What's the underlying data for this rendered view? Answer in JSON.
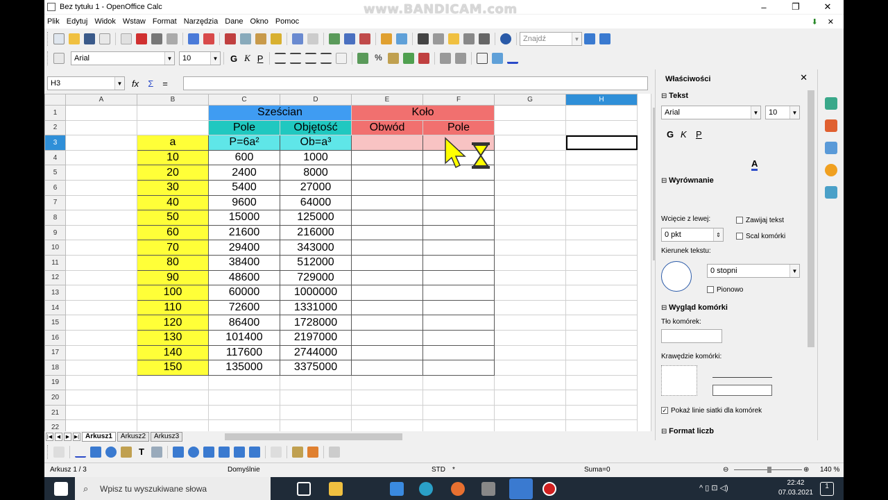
{
  "window": {
    "title": "Bez tytułu 1 - OpenOffice Calc",
    "watermark": "www.BANDICAM.com",
    "controls": [
      "–",
      "❐",
      "✕"
    ]
  },
  "menu": {
    "items": [
      "Plik",
      "Edytuj",
      "Widok",
      "Wstaw",
      "Format",
      "Narzędzia",
      "Dane",
      "Okno",
      "Pomoc"
    ],
    "close": "✕"
  },
  "toolbar": {
    "find_placeholder": "Znajdź",
    "font_name": "Arial",
    "font_size": "10",
    "bold": "G",
    "italic": "K",
    "underline": "P"
  },
  "formula_bar": {
    "name_box": "H3",
    "fx": "fx",
    "sum": "Σ",
    "equals": "=",
    "content": ""
  },
  "sheet": {
    "columns": [
      "A",
      "B",
      "C",
      "D",
      "E",
      "F",
      "G",
      "H"
    ],
    "selected_column": "H",
    "selected_row": "3",
    "header_cells": {
      "cube": "Sześcian",
      "circle": "Koło",
      "area": "Pole",
      "volume": "Objętość",
      "perimeter": "Obwód",
      "circle_area": "Pole",
      "a": "a",
      "area_formula": "P=6a²",
      "volume_formula": "Ob=a³"
    },
    "rows": [
      {
        "a": "10",
        "p": "600",
        "v": "1000"
      },
      {
        "a": "20",
        "p": "2400",
        "v": "8000"
      },
      {
        "a": "30",
        "p": "5400",
        "v": "27000"
      },
      {
        "a": "40",
        "p": "9600",
        "v": "64000"
      },
      {
        "a": "50",
        "p": "15000",
        "v": "125000"
      },
      {
        "a": "60",
        "p": "21600",
        "v": "216000"
      },
      {
        "a": "70",
        "p": "29400",
        "v": "343000"
      },
      {
        "a": "80",
        "p": "38400",
        "v": "512000"
      },
      {
        "a": "90",
        "p": "48600",
        "v": "729000"
      },
      {
        "a": "100",
        "p": "60000",
        "v": "1000000"
      },
      {
        "a": "110",
        "p": "72600",
        "v": "1331000"
      },
      {
        "a": "120",
        "p": "86400",
        "v": "1728000"
      },
      {
        "a": "130",
        "p": "101400",
        "v": "2197000"
      },
      {
        "a": "140",
        "p": "117600",
        "v": "2744000"
      },
      {
        "a": "150",
        "p": "135000",
        "v": "3375000"
      }
    ],
    "row_numbers": [
      "1",
      "2",
      "3",
      "4",
      "5",
      "6",
      "7",
      "8",
      "9",
      "10",
      "11",
      "12",
      "13",
      "14",
      "15",
      "16",
      "17",
      "18",
      "19",
      "20",
      "21",
      "22"
    ],
    "tabs": [
      "Arkusz1",
      "Arkusz2",
      "Arkusz3"
    ],
    "active_tab": "Arkusz1"
  },
  "status": {
    "sheet": "Arkusz 1 / 3",
    "style": "Domyślnie",
    "mode": "STD",
    "modified": "*",
    "sum": "Suma=0",
    "zoom": "140 %"
  },
  "sidebar": {
    "title": "Właściwości",
    "sections": {
      "text": "Tekst",
      "alignment": "Wyrównanie",
      "cell_look": "Wygląd komórki",
      "number_format": "Format liczb"
    },
    "font": "Arial",
    "font_size": "10",
    "indent_label": "Wcięcie z lewej:",
    "indent_value": "0 pkt",
    "wrap_text": "Zawijaj tekst",
    "merge_cells": "Scal komórki",
    "direction_label": "Kierunek tekstu:",
    "degrees": "0 stopni",
    "vertical": "Pionowo",
    "background_label": "Tło komórek:",
    "borders_label": "Krawędzie komórki:",
    "gridlines": "Pokaż linie siatki dla komórek"
  },
  "taskbar": {
    "search_placeholder": "Wpisz tu wyszukiwane słowa",
    "time": "22:42",
    "date": "07.03.2021",
    "notifications": "1"
  },
  "colors": {
    "yellow": "#ffff38",
    "blue": "#3f9cf2",
    "teal": "#20c8c0",
    "cyan": "#5fe6e8",
    "red": "#f1706f",
    "pink": "#f8c3c3",
    "selection": "#2f8fd8"
  }
}
